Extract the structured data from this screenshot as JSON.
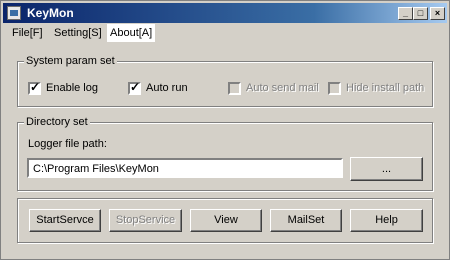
{
  "window": {
    "title": "KeyMon"
  },
  "titlebar_buttons": {
    "minimize": "_",
    "maximize": "□",
    "close": "×"
  },
  "menu": [
    {
      "label": "File[F]"
    },
    {
      "label": "Setting[S]"
    },
    {
      "label": "About[A]"
    }
  ],
  "system_params": {
    "group_label": "System param set",
    "enable_log": {
      "label": "Enable log",
      "checked": true,
      "enabled": true
    },
    "auto_run": {
      "label": "Auto run",
      "checked": true,
      "enabled": true
    },
    "auto_send_mail": {
      "label": "Auto send mail",
      "checked": false,
      "enabled": false
    },
    "hide_install_path": {
      "label": "Hide install path",
      "checked": false,
      "enabled": false
    },
    "check_mark": "✓"
  },
  "directory": {
    "group_label": "Directory set",
    "path_label": "Logger file path:",
    "path_value": "C:\\Program Files\\KeyMon",
    "browse_label": "..."
  },
  "buttons": {
    "start": "StartServce",
    "stop": "StopService",
    "view": "View",
    "mailset": "MailSet",
    "help": "Help"
  }
}
